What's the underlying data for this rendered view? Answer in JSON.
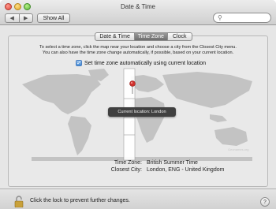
{
  "window": {
    "title": "Date & Time"
  },
  "toolbar": {
    "back_icon": "◀",
    "forward_icon": "▶",
    "show_all_label": "Show All",
    "search_placeholder": ""
  },
  "tabs": [
    {
      "label": "Date & Time",
      "selected": false
    },
    {
      "label": "Time Zone",
      "selected": true
    },
    {
      "label": "Clock",
      "selected": false
    }
  ],
  "instructions": [
    "To select a time zone, click the map near your location and choose a city from the Closest City menu.",
    "You can also have the time zone change automatically, if possible, based on your current location."
  ],
  "auto_location": {
    "label": "Set time zone automatically using current location",
    "checked": true
  },
  "map": {
    "tooltip": "Current location: London",
    "watermark": "Geonames.org"
  },
  "time_zone": {
    "label": "Time Zone:",
    "value": "British Summer Time"
  },
  "closest_city": {
    "label": "Closest City:",
    "value": "London, ENG - United Kingdom"
  },
  "footer": {
    "lock_text": "Click the lock to prevent further changes.",
    "help_label": "?"
  },
  "colors": {
    "accent": "#3d86d4",
    "selected_tab": "#7a7a7a",
    "marker": "#d0312d"
  }
}
